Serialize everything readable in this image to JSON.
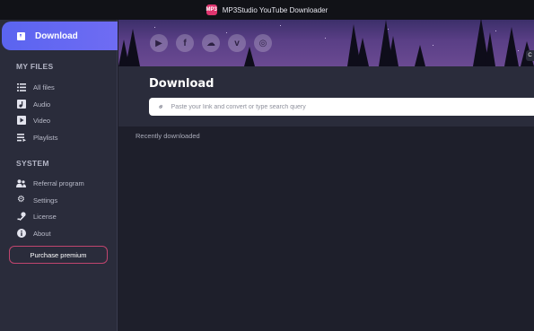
{
  "window": {
    "title": "MP3Studio YouTube Downloader",
    "logo_text": "MP3"
  },
  "sidebar": {
    "download_label": "Download",
    "my_files_title": "MY FILES",
    "my_files": [
      {
        "label": "All files",
        "icon": "list-icon"
      },
      {
        "label": "Audio",
        "icon": "music-icon"
      },
      {
        "label": "Video",
        "icon": "video-icon"
      },
      {
        "label": "Playlists",
        "icon": "playlist-icon"
      }
    ],
    "system_title": "SYSTEM",
    "system": [
      {
        "label": "Referral program",
        "icon": "users-icon"
      },
      {
        "label": "Settings",
        "icon": "gear-icon"
      },
      {
        "label": "License",
        "icon": "key-icon"
      },
      {
        "label": "About",
        "icon": "info-icon"
      }
    ],
    "purchase_label": "Purchase premium"
  },
  "banner": {
    "socials": [
      "youtube-icon",
      "facebook-icon",
      "soundcloud-icon",
      "vimeo-icon",
      "instagram-icon"
    ]
  },
  "main": {
    "title": "Download",
    "search_placeholder": "Paste your link and convert or type search query",
    "recent_label": "Recently downloaded",
    "edge_tab_label": "C"
  },
  "colors": {
    "accent": "#5a64f0",
    "purchase_border": "#c0456e",
    "sidebar_bg": "#2a2c3b",
    "main_bg": "#1e1f2b"
  }
}
